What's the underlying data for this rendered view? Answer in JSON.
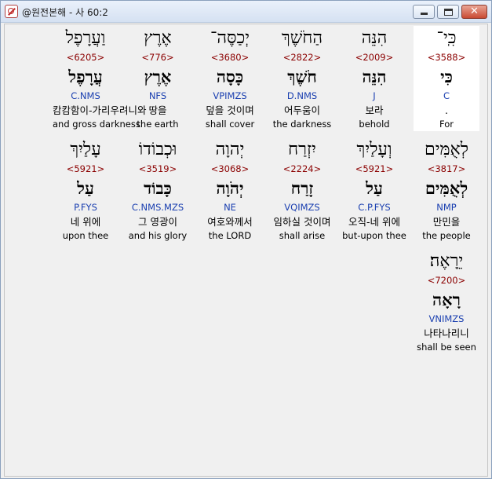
{
  "window": {
    "title": "@원전본해 - 사 60:2",
    "close_label": "✕"
  },
  "rows": [
    [
      {
        "heb": "כִּֽי־",
        "strong": "<3588>",
        "lemma": "כִּי",
        "morph": "C",
        "korean": ".",
        "english": "For",
        "selected": true
      },
      {
        "heb": "הִנֵּה",
        "strong": "<2009>",
        "lemma": "הִנֵּה",
        "morph": "J",
        "korean": "보라",
        "english": "behold"
      },
      {
        "heb": "הַחֹשֶׁךְ",
        "strong": "<2822>",
        "lemma": "חֹשֶׁךְ",
        "morph": "D.NMS",
        "korean": "어두움이",
        "english": "the darkness"
      },
      {
        "heb": "יְכַסֶּה־",
        "strong": "<3680>",
        "lemma": "כָּסָה",
        "morph": "VPIMZS",
        "korean": "덮을 것이며",
        "english": "shall cover"
      },
      {
        "heb": "אֶרֶץ",
        "strong": "<776>",
        "lemma": "אֶרֶץ",
        "morph": "NFS",
        "korean": "땅을",
        "english": "the earth"
      },
      {
        "heb": "וַעֲרָפֶל",
        "strong": "<6205>",
        "lemma": "עֲרָפֶל",
        "morph": "C.NMS",
        "korean": "캄캄함이-가리우려니와",
        "english": "and gross darkness"
      }
    ],
    [
      {
        "heb": "לְאֻמִּים",
        "strong": "<3817>",
        "lemma": "לְאֻמִּים",
        "morph": "NMP",
        "korean": "만민을",
        "english": "the people"
      },
      {
        "heb": "וְעָלַיִךְ",
        "strong": "<5921>",
        "lemma": "עַל",
        "morph": "C.P.FYS",
        "korean": "오직-네 위에",
        "english": "but-upon thee"
      },
      {
        "heb": "יִזְרַח",
        "strong": "<2224>",
        "lemma": "זָרַח",
        "morph": "VQIMZS",
        "korean": "임하실 것이며",
        "english": "shall arise"
      },
      {
        "heb": "יְהוָה",
        "strong": "<3068>",
        "lemma": "יְהֹוָה",
        "morph": "NE",
        "korean": "여호와께서",
        "english": "the LORD"
      },
      {
        "heb": "וּכְבוֹדוֹ",
        "strong": "<3519>",
        "lemma": "כָּבוֹד",
        "morph": "C.NMS.MZS",
        "korean": "그 영광이",
        "english": "and his glory"
      },
      {
        "heb": "עָלַיִךְ",
        "strong": "<5921>",
        "lemma": "עַל",
        "morph": "P.FYS",
        "korean": "네 위에",
        "english": "upon thee"
      }
    ],
    [
      {
        "heb": "יֵרָאֶה׃",
        "strong": "<7200>",
        "lemma": "רָאָה",
        "morph": "VNIMZS",
        "korean": "나타나리니",
        "english": "shall be seen"
      }
    ]
  ]
}
